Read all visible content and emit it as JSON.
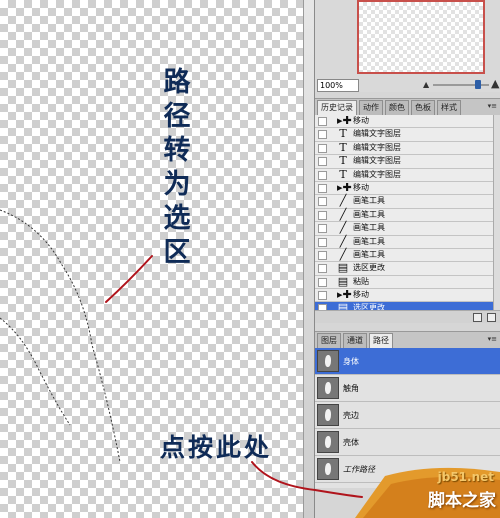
{
  "canvas": {
    "annotation_vertical": [
      "路",
      "径",
      "转",
      "为",
      "选",
      "区"
    ],
    "annotation_click": "点按此处"
  },
  "navigator": {
    "zoom_value": "100%"
  },
  "history_panel": {
    "tabs": [
      {
        "label": "历史记录",
        "active": true
      },
      {
        "label": "动作",
        "active": false
      },
      {
        "label": "颜色",
        "active": false
      },
      {
        "label": "色板",
        "active": false
      },
      {
        "label": "样式",
        "active": false
      }
    ],
    "items": [
      {
        "label": "移动",
        "icon": "move-tool-icon",
        "glyph": "▸✚",
        "selected": false
      },
      {
        "label": "编辑文字图层",
        "icon": "type-layer-icon",
        "glyph": "T",
        "selected": false
      },
      {
        "label": "编辑文字图层",
        "icon": "type-layer-icon",
        "glyph": "T",
        "selected": false
      },
      {
        "label": "编辑文字图层",
        "icon": "type-layer-icon",
        "glyph": "T",
        "selected": false
      },
      {
        "label": "编辑文字图层",
        "icon": "type-layer-icon",
        "glyph": "T",
        "selected": false
      },
      {
        "label": "移动",
        "icon": "move-tool-icon",
        "glyph": "▸✚",
        "selected": false
      },
      {
        "label": "画笔工具",
        "icon": "brush-tool-icon",
        "glyph": "╱",
        "selected": false
      },
      {
        "label": "画笔工具",
        "icon": "brush-tool-icon",
        "glyph": "╱",
        "selected": false
      },
      {
        "label": "画笔工具",
        "icon": "brush-tool-icon",
        "glyph": "╱",
        "selected": false
      },
      {
        "label": "画笔工具",
        "icon": "brush-tool-icon",
        "glyph": "╱",
        "selected": false
      },
      {
        "label": "画笔工具",
        "icon": "brush-tool-icon",
        "glyph": "╱",
        "selected": false
      },
      {
        "label": "选区更改",
        "icon": "selection-change-icon",
        "glyph": "▤",
        "selected": false
      },
      {
        "label": "粘贴",
        "icon": "paste-icon",
        "glyph": "▤",
        "selected": false
      },
      {
        "label": "移动",
        "icon": "move-tool-icon",
        "glyph": "▸✚",
        "selected": false
      },
      {
        "label": "选区更改",
        "icon": "selection-change-icon",
        "glyph": "▤",
        "selected": true
      }
    ]
  },
  "paths_panel": {
    "tabs": [
      {
        "label": "图层",
        "active": false
      },
      {
        "label": "通道",
        "active": false
      },
      {
        "label": "路径",
        "active": true
      }
    ],
    "items": [
      {
        "label": "身体",
        "selected": true,
        "work": false
      },
      {
        "label": "触角",
        "selected": false,
        "work": false
      },
      {
        "label": "壳边",
        "selected": false,
        "work": false
      },
      {
        "label": "壳体",
        "selected": false,
        "work": false
      },
      {
        "label": "工作路径",
        "selected": false,
        "work": true
      }
    ]
  },
  "watermark": {
    "url": "jb51.net",
    "text": "脚本之家"
  },
  "colors": {
    "annotation": "#0f2b57",
    "arrow": "#b0141c",
    "selection": "#3d6dd6",
    "nav_frame": "#c8504b"
  }
}
